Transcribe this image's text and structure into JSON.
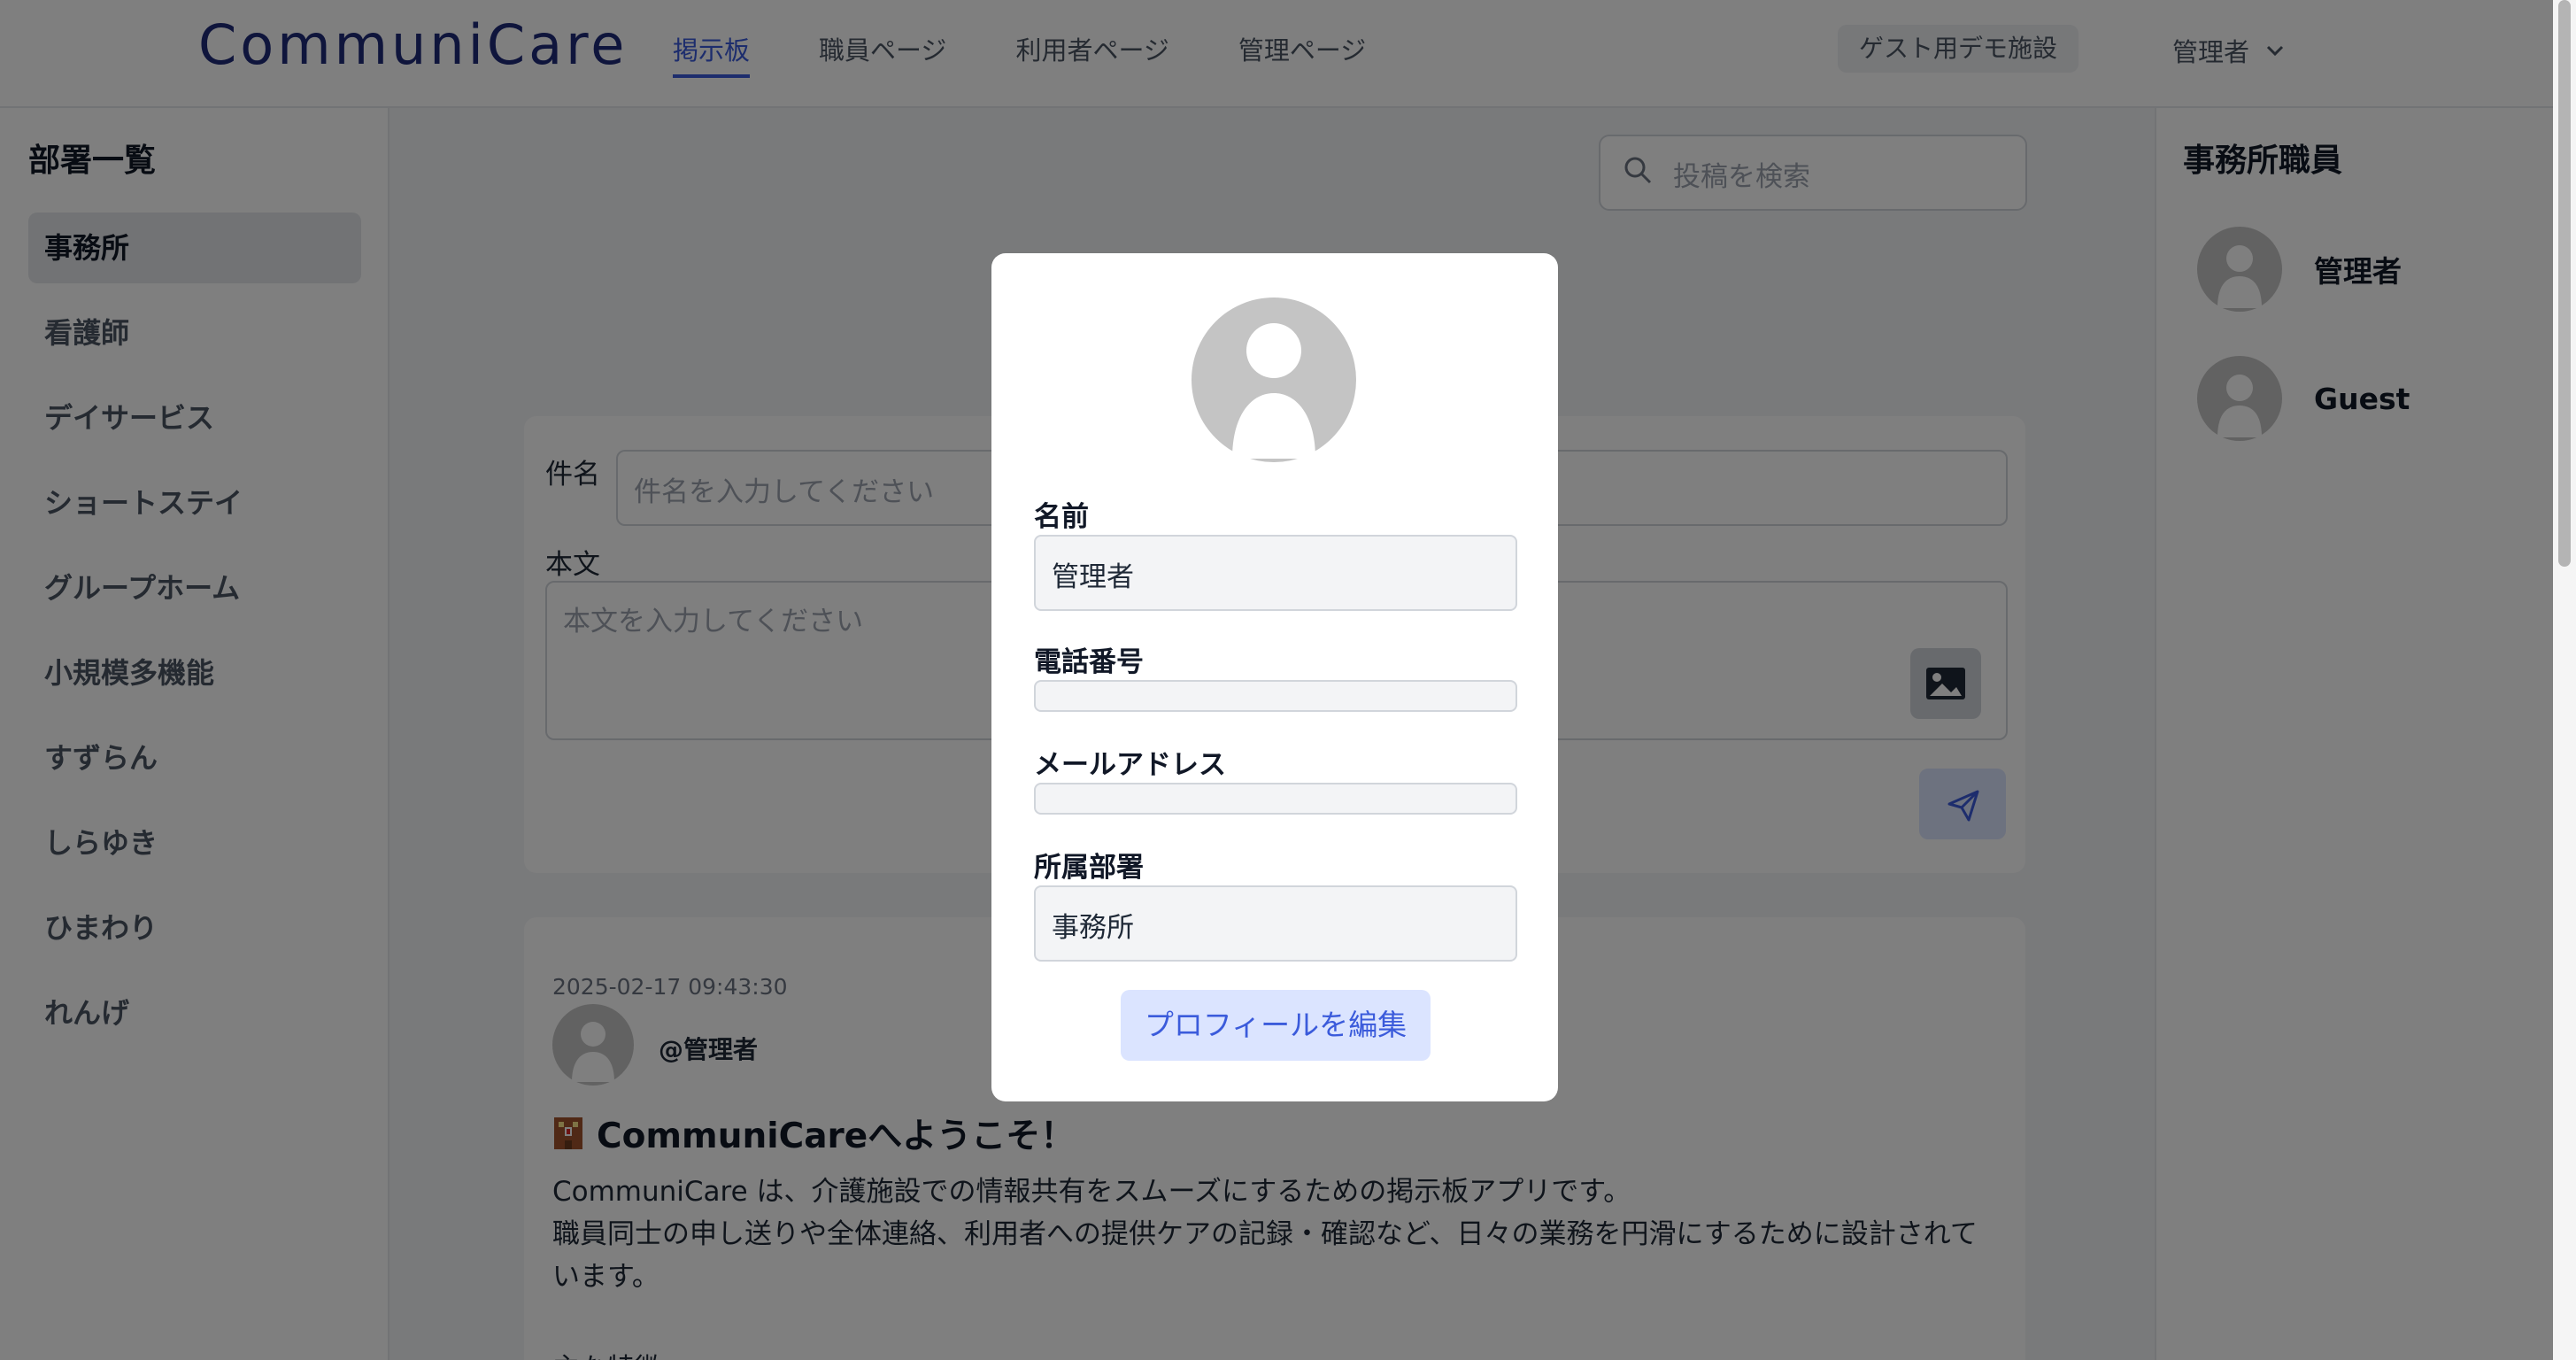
{
  "header": {
    "logo": "CommuniCare",
    "nav": [
      "掲示板",
      "職員ページ",
      "利用者ページ",
      "管理ページ"
    ],
    "facility": "ゲスト用デモ施設",
    "user": "管理者"
  },
  "sidebar": {
    "title": "部署一覧",
    "departments": [
      "事務所",
      "看護師",
      "デイサービス",
      "ショートステイ",
      "グループホーム",
      "小規模多機能",
      "すずらん",
      "しらゆき",
      "ひまわり",
      "れんげ"
    ],
    "active": "事務所"
  },
  "search": {
    "placeholder": "投稿を検索"
  },
  "composer": {
    "subject_label": "件名",
    "subject_placeholder": "件名を入力してください",
    "body_label": "本文",
    "body_placeholder": "本文を入力してください"
  },
  "post": {
    "timestamp": "2025-02-17 09:43:30",
    "author": "@管理者",
    "title": "CommuniCareへようこそ！",
    "body_line1": "CommuniCare は、介護施設での情報共有をスムーズにするための掲示板アプリです。",
    "body_line2": "職員同士の申し送りや全体連絡、利用者への提供ケアの記録・確認など、日々の業務を円滑にするために設計されています。",
    "more": "主な特徴"
  },
  "right_sidebar": {
    "title": "事務所職員",
    "staff": [
      "管理者",
      "Guest"
    ]
  },
  "modal": {
    "name_label": "名前",
    "name_value": "管理者",
    "phone_label": "電話番号",
    "phone_value": "",
    "email_label": "メールアドレス",
    "email_value": "",
    "dept_label": "所属部署",
    "dept_value": "事務所",
    "edit_button": "プロフィールを編集"
  },
  "colors": {
    "accent": "#3b5bdb",
    "logo": "#1e2a78",
    "overlay": "rgba(0,0,0,0.5)"
  },
  "icons": [
    "search-icon",
    "image-icon",
    "send-icon",
    "chevron-down-icon",
    "avatar-icon",
    "building-icon"
  ]
}
